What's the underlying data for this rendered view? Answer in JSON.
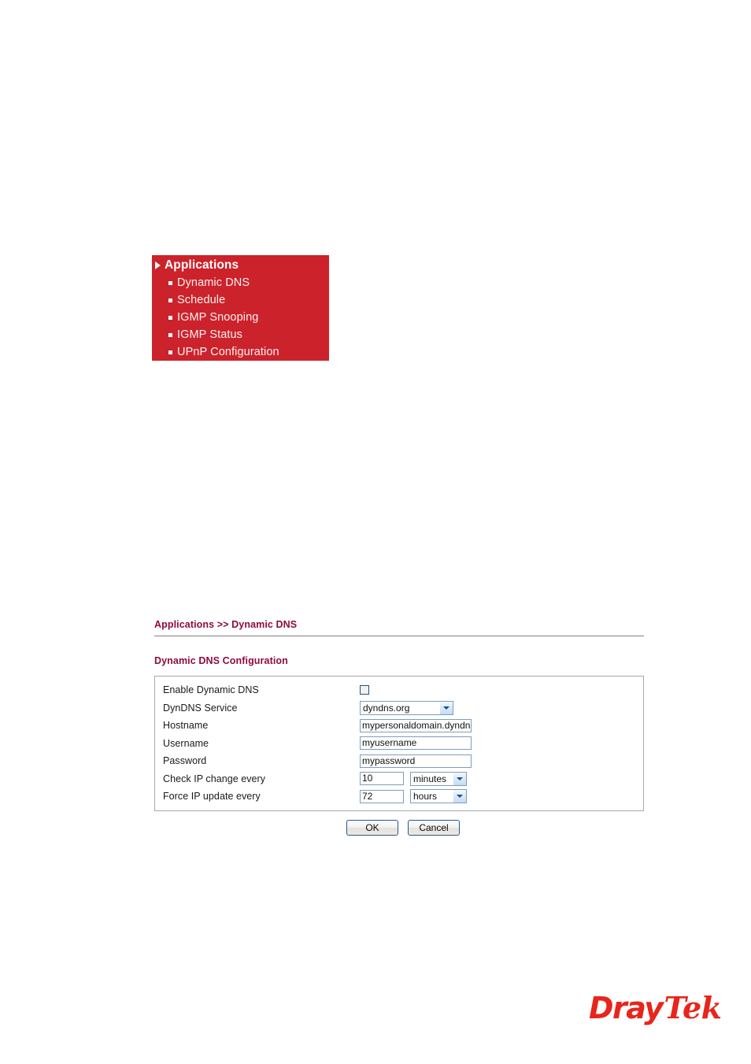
{
  "menu": {
    "header": {
      "label": "Applications",
      "bullet_icon": "triangle-right-icon"
    },
    "items": [
      {
        "label": "Dynamic DNS",
        "bullet_icon": "square-bullet-icon"
      },
      {
        "label": "Schedule",
        "bullet_icon": "square-bullet-icon"
      },
      {
        "label": "IGMP Snooping",
        "bullet_icon": "square-bullet-icon"
      },
      {
        "label": "IGMP Status",
        "bullet_icon": "square-bullet-icon"
      },
      {
        "label": "UPnP Configuration",
        "bullet_icon": "square-bullet-icon"
      }
    ],
    "background_color": "#cc222b",
    "header_text_color": "#ffffff",
    "item_text_color": "#fdf1f1"
  },
  "page": {
    "breadcrumb": "Applications >> Dynamic DNS",
    "section_title": "Dynamic DNS Configuration",
    "heading_color": "#8e0b3f"
  },
  "form": {
    "enable": {
      "label": "Enable Dynamic DNS",
      "checked": false
    },
    "service": {
      "label": "DynDNS Service",
      "value": "dyndns.org",
      "dropdown_icon": "chevron-down-icon"
    },
    "hostname": {
      "label": "Hostname",
      "value": "mypersonaldomain.dyndns.org",
      "placeholder": ""
    },
    "username": {
      "label": "Username",
      "value": "myusername",
      "placeholder": ""
    },
    "password": {
      "label": "Password",
      "value": "mypassword",
      "placeholder": ""
    },
    "check_ip": {
      "label": "Check IP change every",
      "value": "10",
      "unit": "minutes",
      "dropdown_icon": "chevron-down-icon"
    },
    "force_update": {
      "label": "Force IP update every",
      "value": "72",
      "unit": "hours",
      "dropdown_icon": "chevron-down-icon"
    }
  },
  "buttons": {
    "ok": "OK",
    "cancel": "Cancel"
  },
  "logo": {
    "part1": "Dray",
    "part2": "Tek",
    "color": "#e8251c"
  }
}
